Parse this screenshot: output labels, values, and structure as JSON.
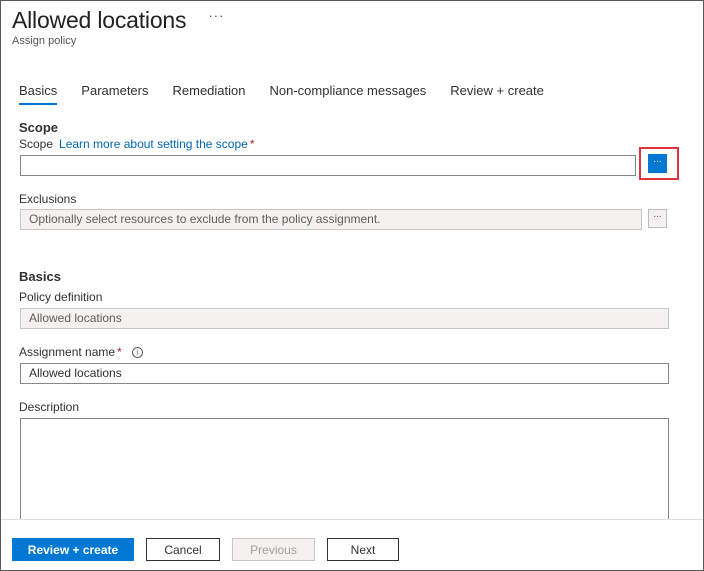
{
  "header": {
    "title": "Allowed locations",
    "subtitle": "Assign policy",
    "more_icon": "···"
  },
  "tabs": [
    {
      "label": "Basics",
      "active": true
    },
    {
      "label": "Parameters",
      "active": false
    },
    {
      "label": "Remediation",
      "active": false
    },
    {
      "label": "Non-compliance messages",
      "active": false
    },
    {
      "label": "Review + create",
      "active": false
    }
  ],
  "scope_section": {
    "title": "Scope",
    "scope_label": "Scope",
    "scope_link": "Learn more about setting the scope",
    "required_mark": "*",
    "scope_value": "",
    "browse_label": "...",
    "exclusions_label": "Exclusions",
    "exclusions_placeholder": "Optionally select resources to exclude from the policy assignment.",
    "exclusions_browse_label": "..."
  },
  "basics_section": {
    "title": "Basics",
    "policy_definition_label": "Policy definition",
    "policy_definition_value": "Allowed locations",
    "assignment_name_label": "Assignment name",
    "required_mark": "*",
    "info_icon": "i",
    "assignment_name_value": "Allowed locations",
    "description_label": "Description",
    "description_value": ""
  },
  "footer": {
    "review_create": "Review + create",
    "cancel": "Cancel",
    "previous": "Previous",
    "next": "Next"
  },
  "colors": {
    "accent": "#0078d4",
    "highlight": "#e0343c",
    "required": "#a4262c",
    "link": "#0067b8"
  }
}
